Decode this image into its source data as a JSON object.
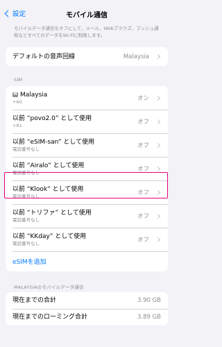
{
  "nav": {
    "back_label": "設定",
    "title": "モバイル通信"
  },
  "description": "モバイルデータ通信をオフにして、メール、Webブラウズ、プッシュ通知などすべてのデータをWi-Fiに制限します。",
  "default_voice": {
    "label": "デフォルトの音声回線",
    "value": "Malaysia"
  },
  "sim_section": {
    "header": "SIM",
    "lines": [
      {
        "title": "Malaysia",
        "sub": "+60",
        "value": "オン",
        "badge": "M"
      },
      {
        "title": "以前 “povo2.0” として使用",
        "sub": "+81",
        "value": "オフ"
      },
      {
        "title": "以前 “eSIM-san” として使用",
        "sub": "電話番号なし",
        "value": "オフ"
      },
      {
        "title": "以前 “Airalo” として使用",
        "sub": "電話番号なし",
        "value": "オフ"
      },
      {
        "title": "以前 “Klook” として使用",
        "sub": "電話番号なし",
        "value": "オフ"
      },
      {
        "title": "以前 “トリファ” として使用",
        "sub": "電話番号なし",
        "value": "オフ"
      },
      {
        "title": "以前 “KKday” として使用",
        "sub": "電話番号なし",
        "value": "オフ"
      }
    ],
    "add_esim": "eSIMを追加"
  },
  "usage_section": {
    "header": "MALAYSIAのモバイルデータ通信",
    "rows": [
      {
        "label": "現在までの合計",
        "value": "3.90 GB"
      },
      {
        "label": "現在までのローミング合計",
        "value": "3.89 GB"
      }
    ]
  },
  "colors": {
    "accent": "#007aff",
    "highlight": "#e6007e",
    "background": "#f2f2f7"
  }
}
